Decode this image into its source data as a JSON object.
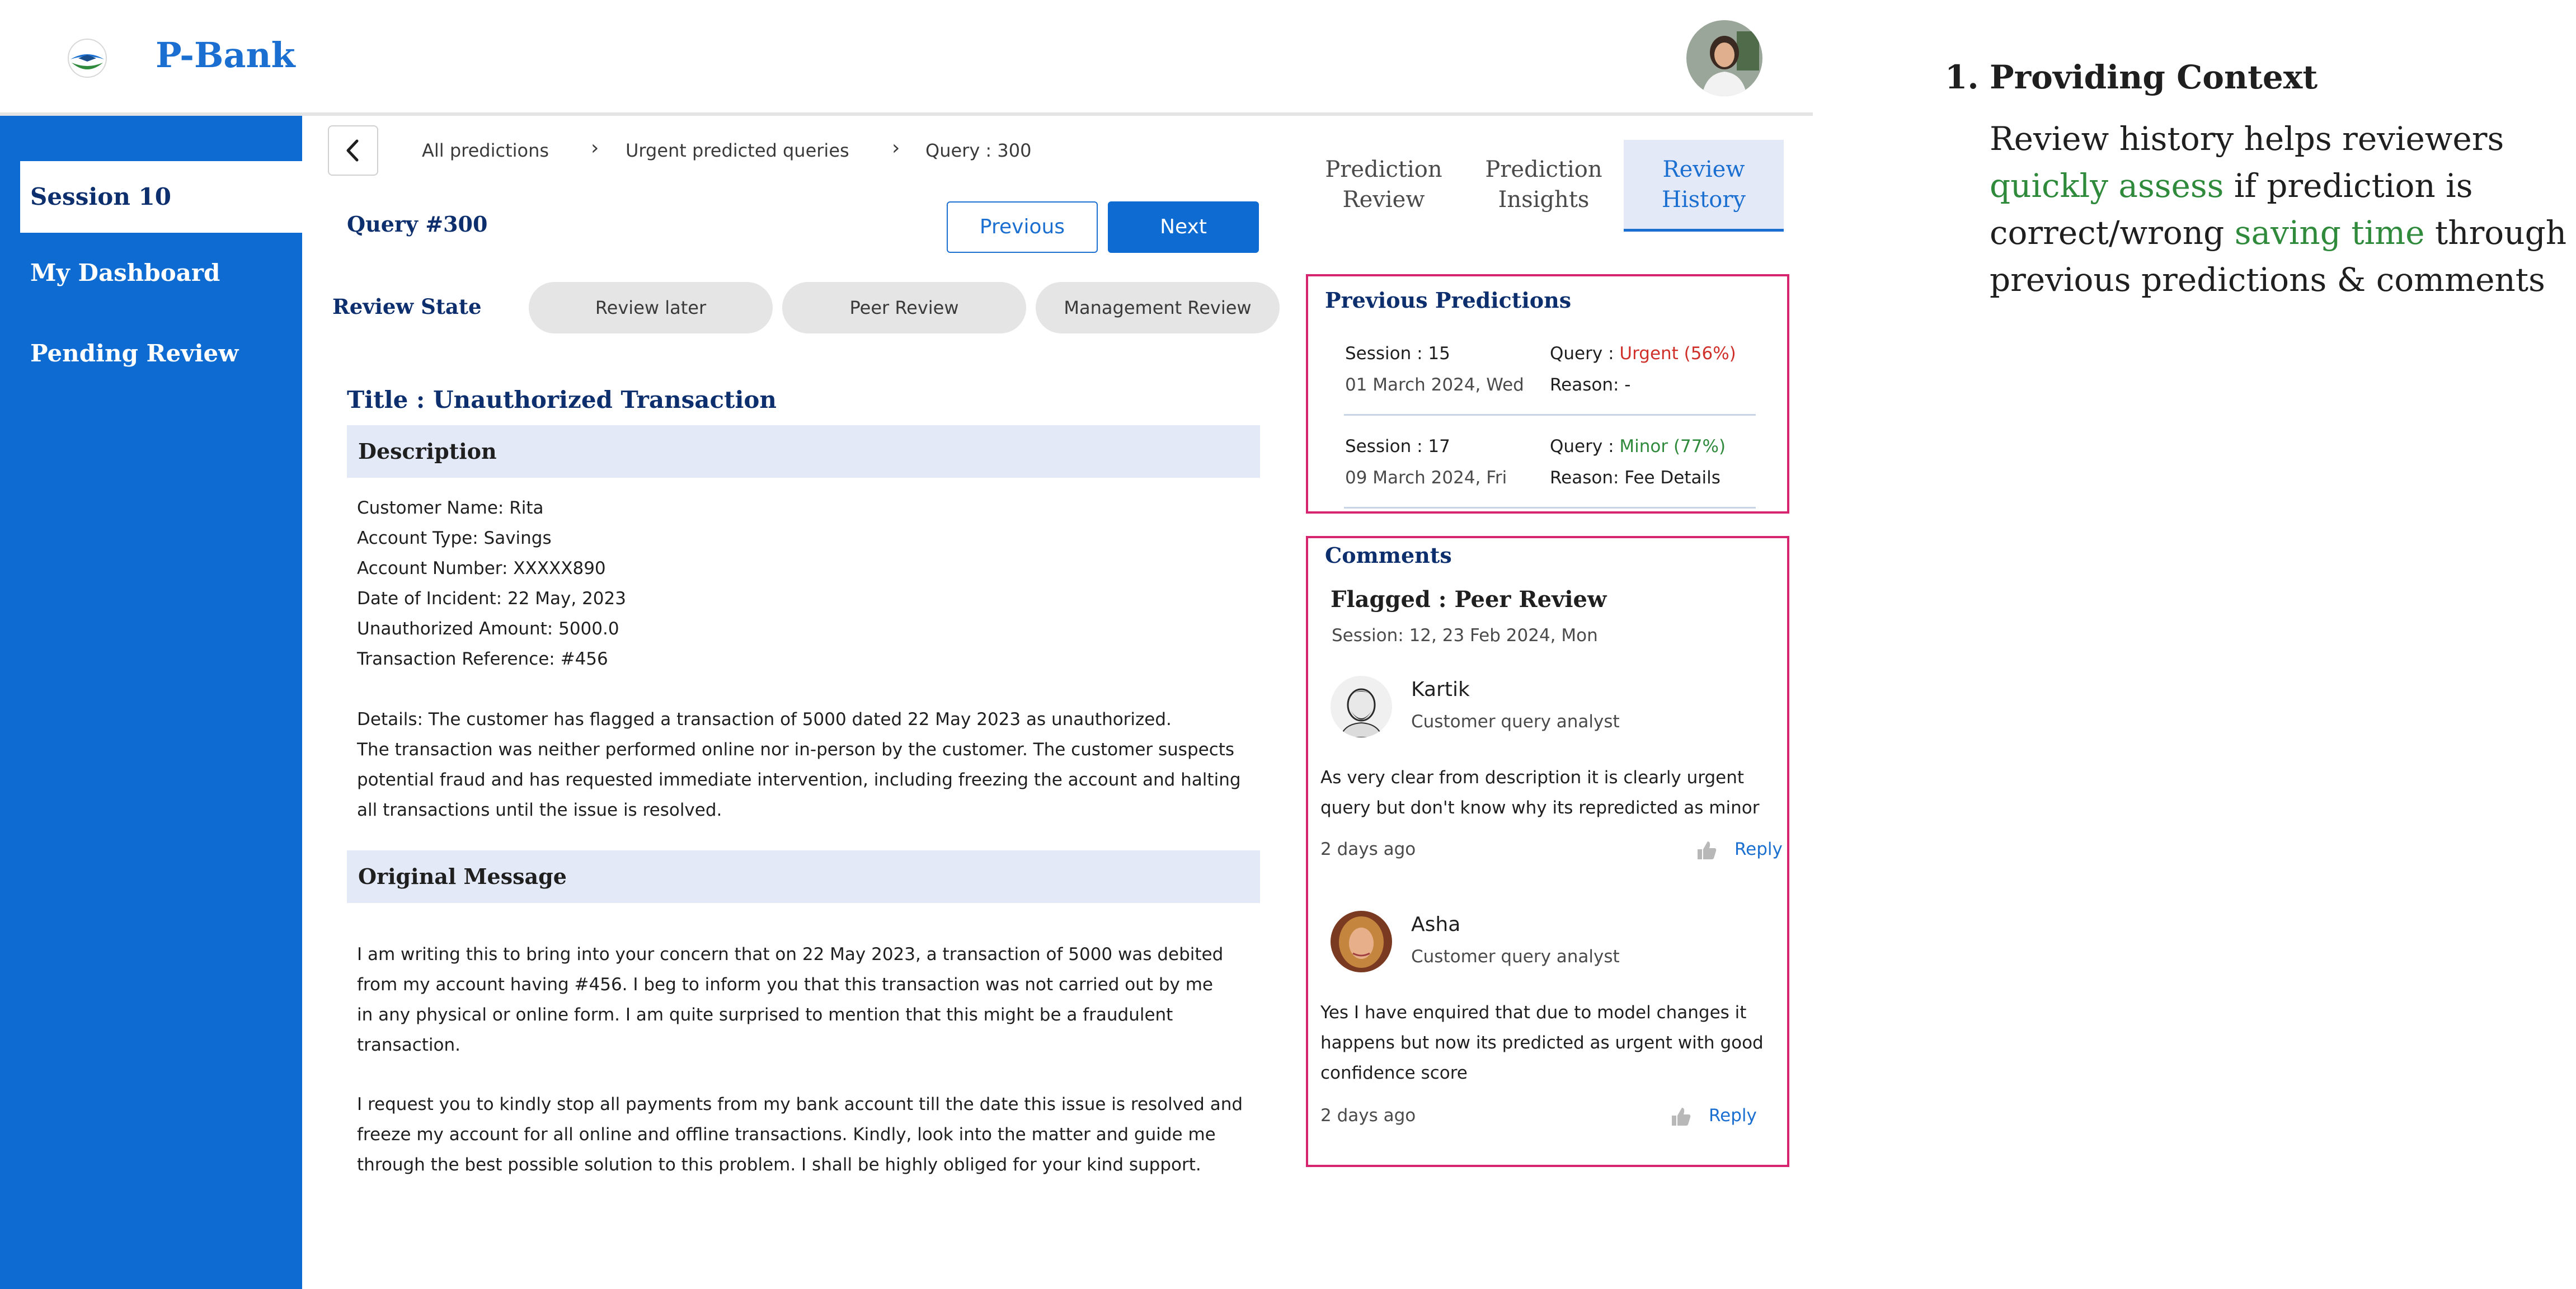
{
  "header": {
    "brand": "P-Bank"
  },
  "sidebar": {
    "items": [
      {
        "label": "Session 10"
      },
      {
        "label": "My Dashboard"
      },
      {
        "label": "Pending Review"
      }
    ]
  },
  "breadcrumb": {
    "items": [
      "All predictions",
      "Urgent predicted queries",
      "Query : 300"
    ]
  },
  "query": {
    "title": "Query #300",
    "previous_label": "Previous",
    "next_label": "Next",
    "review_state_label": "Review State",
    "states": [
      "Review later",
      "Peer Review",
      "Management Review"
    ]
  },
  "content": {
    "title": "Title : Unauthorized Transaction",
    "description_heading": "Description",
    "description_fields": [
      "Customer Name: Rita",
      "Account Type: Savings",
      "Account Number: XXXXX890",
      "Date of Incident: 22 May, 2023",
      "Unauthorized Amount: 5000.0",
      "Transaction Reference: #456"
    ],
    "details_lines": [
      "Details: The customer has flagged a transaction of 5000 dated 22 May 2023 as unauthorized.",
      "The transaction was neither performed online nor in-person by the customer. The customer suspects",
      "potential fraud and has requested immediate intervention, including freezing the account and halting",
      "all transactions until the issue is resolved."
    ],
    "original_heading": "Original Message",
    "original_lines": [
      "I am writing this to bring into your concern that on 22 May 2023, a transaction of 5000 was debited",
      "from my account having #456. I beg to inform you that this transaction was not carried out by me",
      "in any physical or online form. I am quite surprised to mention that this might be a fraudulent",
      "transaction.",
      "I request you to kindly stop all payments from my bank account till the date this issue is resolved and",
      "freeze  my account for all online and offline transactions. Kindly, look into the matter and guide me",
      "through the best possible solution to this problem. I shall be highly obliged for your kind support."
    ]
  },
  "tabs": [
    {
      "line1": "Prediction",
      "line2": "Review"
    },
    {
      "line1": "Prediction",
      "line2": "Insights"
    },
    {
      "line1": "Review",
      "line2": "History"
    }
  ],
  "previous_predictions": {
    "heading": "Previous Predictions",
    "entries": [
      {
        "session": "Session : 15",
        "date": "01 March 2024, Wed",
        "query_label": "Query : ",
        "query_value": "Urgent (56%)",
        "reason": "Reason: -"
      },
      {
        "session": "Session : 17",
        "date": "09 March 2024, Fri",
        "query_label": "Query : ",
        "query_value": "Minor (77%)",
        "reason": "Reason: Fee Details"
      }
    ]
  },
  "comments": {
    "heading": "Comments",
    "flag": "Flagged : Peer Review",
    "session_info": "Session: 12,  23 Feb 2024,  Mon",
    "items": [
      {
        "author": "Kartik",
        "role": "Customer query analyst",
        "lines": [
          "As very clear from description it is clearly urgent",
          "query but don't know why its repredicted as minor"
        ],
        "time": "2 days ago",
        "reply": "Reply"
      },
      {
        "author": "Asha",
        "role": "Customer query analyst",
        "lines": [
          "Yes I have enquired that due to model changes it",
          "happens but now its predicted as urgent with good",
          "confidence score"
        ],
        "time": "2 days ago",
        "reply": "Reply"
      }
    ]
  },
  "annotation": {
    "number": "1.",
    "heading": "Providing Context",
    "line1": "Review history helps reviewers",
    "line2_green": "quickly assess",
    "line2_rest": " if prediction is",
    "line3_start": "correct/wrong ",
    "line3_green": "saving time",
    "line3_rest": " through",
    "line4": "previous predictions & comments"
  },
  "colors": {
    "primary": "#0e6bd1",
    "accent_border": "#d6246e",
    "urgent": "#d0302a",
    "minor": "#2f8a3c"
  }
}
